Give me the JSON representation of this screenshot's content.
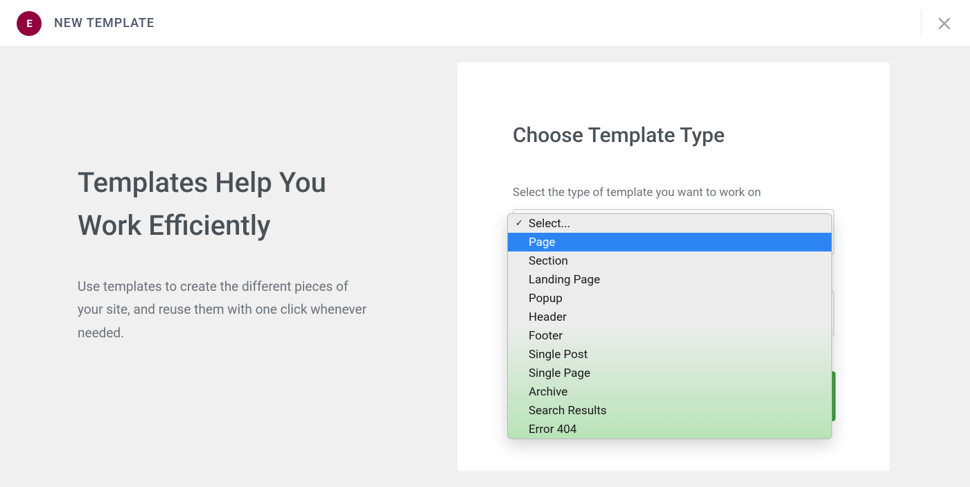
{
  "header": {
    "logo_text": "E",
    "title": "NEW TEMPLATE"
  },
  "left": {
    "title": "Templates Help You Work Efficiently",
    "description": "Use templates to create the different pieces of your site, and reuse them with one click whenever needed."
  },
  "card": {
    "title": "Choose Template Type",
    "type_label": "Select the type of template you want to work on"
  },
  "dropdown": {
    "placeholder": "Select...",
    "options": [
      "Page",
      "Section",
      "Landing Page",
      "Popup",
      "Header",
      "Footer",
      "Single Post",
      "Single Page",
      "Archive",
      "Search Results",
      "Error 404"
    ],
    "highlighted_index": 0
  }
}
